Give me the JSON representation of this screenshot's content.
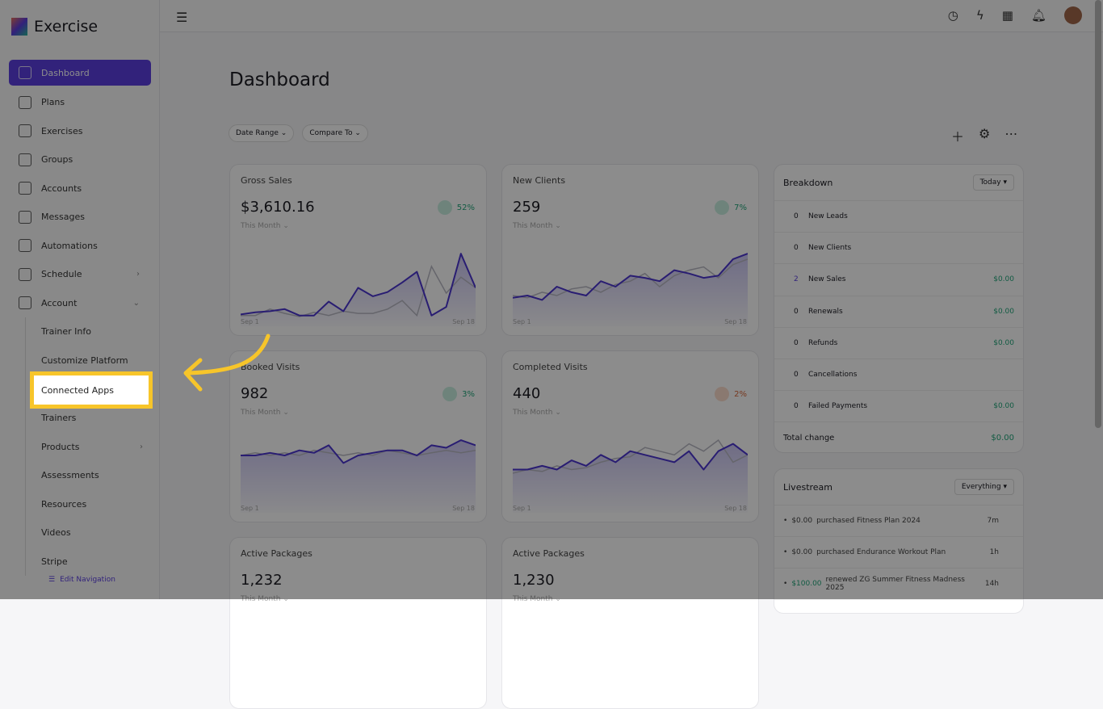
{
  "app": {
    "name": "Exercise"
  },
  "sidebar": {
    "items": [
      {
        "label": "Dashboard"
      },
      {
        "label": "Plans"
      },
      {
        "label": "Exercises"
      },
      {
        "label": "Groups"
      },
      {
        "label": "Accounts"
      },
      {
        "label": "Messages"
      },
      {
        "label": "Automations"
      },
      {
        "label": "Schedule"
      },
      {
        "label": "Account"
      }
    ],
    "sub": [
      {
        "label": "Trainer Info"
      },
      {
        "label": "Customize Platform"
      },
      {
        "label": "Connected Apps"
      },
      {
        "label": "Trainers"
      },
      {
        "label": "Products"
      },
      {
        "label": "Assessments"
      },
      {
        "label": "Resources"
      },
      {
        "label": "Videos"
      },
      {
        "label": "Stripe"
      }
    ],
    "edit_nav": "Edit Navigation"
  },
  "page": {
    "title": "Dashboard",
    "date_range": "Date Range",
    "compare_to": "Compare To"
  },
  "cards": [
    {
      "title": "Gross Sales",
      "value": "$3,610.16",
      "change": "52%",
      "dir": "up",
      "period": "This Month",
      "start": "Sep 1",
      "end": "Sep 18",
      "series": [
        5,
        7,
        8,
        10,
        4,
        4,
        17,
        8,
        30,
        22,
        26,
        35,
        45,
        4,
        12,
        62,
        30
      ],
      "prev": [
        4,
        4,
        10,
        6,
        3,
        7,
        4,
        8,
        6,
        6,
        10,
        18,
        4,
        50,
        25,
        40,
        30
      ]
    },
    {
      "title": "New Clients",
      "value": "259",
      "change": "7%",
      "dir": "up",
      "period": "This Month",
      "start": "Sep 1",
      "end": "Sep 18",
      "series": [
        20,
        22,
        18,
        30,
        25,
        22,
        35,
        30,
        40,
        38,
        35,
        45,
        42,
        38,
        40,
        55,
        60
      ],
      "prev": [
        22,
        20,
        25,
        22,
        28,
        30,
        25,
        32,
        35,
        42,
        30,
        40,
        45,
        48,
        38,
        50,
        55
      ]
    },
    {
      "title": "Booked Visits",
      "value": "982",
      "change": "3%",
      "dir": "up",
      "period": "This Month",
      "start": "Sep 1",
      "end": "Sep 18",
      "series": [
        20,
        20,
        21,
        20,
        22,
        21,
        24,
        17,
        20,
        21,
        22,
        22,
        20,
        24,
        23,
        26,
        24
      ],
      "prev": [
        20,
        21,
        20,
        21,
        20,
        22,
        21,
        20,
        21,
        20,
        22,
        21,
        20,
        21,
        22,
        21,
        22
      ]
    },
    {
      "title": "Completed Visits",
      "value": "440",
      "change": "2%",
      "dir": "down",
      "period": "This Month",
      "start": "Sep 1",
      "end": "Sep 18",
      "series": [
        20,
        20,
        22,
        20,
        25,
        22,
        28,
        24,
        30,
        28,
        26,
        24,
        30,
        20,
        30,
        34,
        28
      ],
      "prev": [
        18,
        20,
        19,
        22,
        20,
        21,
        24,
        26,
        27,
        32,
        30,
        28,
        34,
        30,
        36,
        24,
        28
      ]
    },
    {
      "title": "Active Packages",
      "value": "1,232",
      "period": "This Month"
    },
    {
      "title": "Active Packages",
      "value": "1,230",
      "period": "This Month"
    }
  ],
  "breakdown": {
    "title": "Breakdown",
    "filter": "Today",
    "rows": [
      {
        "n": "0",
        "label": "New Leads",
        "amount": ""
      },
      {
        "n": "0",
        "label": "New Clients",
        "amount": ""
      },
      {
        "n": "2",
        "label": "New Sales",
        "amount": "$0.00"
      },
      {
        "n": "0",
        "label": "Renewals",
        "amount": "$0.00"
      },
      {
        "n": "0",
        "label": "Refunds",
        "amount": "$0.00"
      },
      {
        "n": "0",
        "label": "Cancellations",
        "amount": ""
      },
      {
        "n": "0",
        "label": "Failed Payments",
        "amount": "$0.00"
      }
    ],
    "total_label": "Total change",
    "total": "$0.00"
  },
  "livestream": {
    "title": "Livestream",
    "filter": "Everything",
    "items": [
      {
        "amount": "$0.00",
        "text": "purchased Fitness Plan 2024",
        "time": "7m"
      },
      {
        "amount": "$0.00",
        "text": "purchased Endurance Workout Plan",
        "time": "1h"
      },
      {
        "amount": "$100.00",
        "text": "renewed ZG Summer Fitness Madness 2025",
        "time": "14h"
      }
    ]
  },
  "colors": {
    "accent": "#5b3fe0",
    "highlight": "#f7c52a",
    "positive": "#22a67a"
  }
}
